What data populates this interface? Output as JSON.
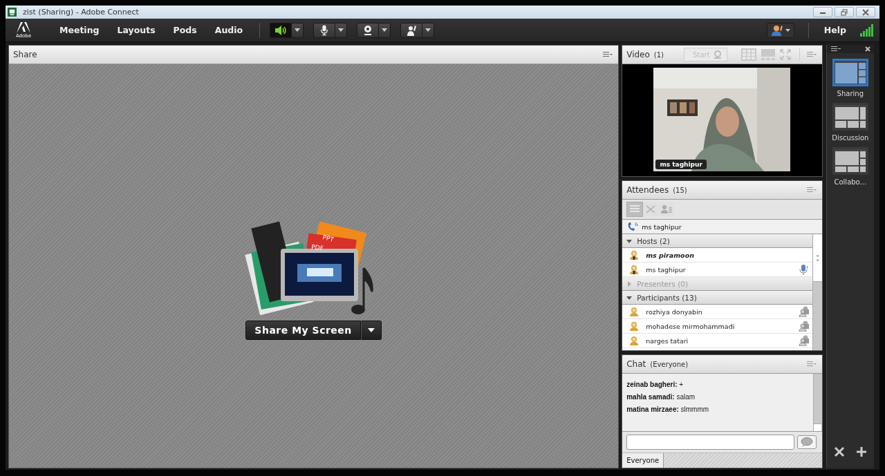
{
  "window": {
    "title": "zist (Sharing) - Adobe Connect"
  },
  "logo": {
    "text": "Adobe"
  },
  "menu": [
    {
      "label": "Meeting"
    },
    {
      "label": "Layouts"
    },
    {
      "label": "Pods"
    },
    {
      "label": "Audio"
    }
  ],
  "toolbar": [
    {
      "kind": "speaker",
      "on": true
    },
    {
      "kind": "mic",
      "on": false
    },
    {
      "kind": "camera",
      "on": false
    },
    {
      "kind": "hand",
      "on": false
    }
  ],
  "help": "Help",
  "share_pod": {
    "title": "Share",
    "button": "Share My Screen",
    "file_labels": [
      "PPT",
      "PDF"
    ]
  },
  "video_pod": {
    "title": "Video",
    "count": "(1)",
    "start": "Start",
    "name_tag": "ms taghipur"
  },
  "attendees_pod": {
    "title": "Attendees",
    "count": "(15)",
    "phone_user": "ms taghipur",
    "groups": [
      {
        "label": "Hosts (2)",
        "expanded": true,
        "children": [
          {
            "name": "ms piramoon",
            "is_me": true,
            "kind": "host",
            "mic_on": false
          },
          {
            "name": "ms taghipur",
            "is_me": false,
            "kind": "host",
            "mic_on": true
          }
        ]
      },
      {
        "label": "Presenters (0)",
        "expanded": false
      },
      {
        "label": "Participants (13)",
        "expanded": true,
        "children": [
          {
            "name": "rozhiya donyabin",
            "is_me": false,
            "kind": "participant"
          },
          {
            "name": "mohadese mirmohammadi",
            "is_me": false,
            "kind": "participant"
          },
          {
            "name": "narges tatari",
            "is_me": false,
            "kind": "participant"
          }
        ]
      }
    ]
  },
  "chat_pod": {
    "title": "Chat",
    "scope": "(Everyone)",
    "messages": [
      {
        "sender": "zeinab bagheri:",
        "text": "+"
      },
      {
        "sender": "mahla samadi:",
        "text": "salam"
      },
      {
        "sender": "matina mirzaee:",
        "text": "slmmmm"
      }
    ],
    "tabs": [
      {
        "label": "Everyone",
        "selected": true
      }
    ]
  },
  "layouts": [
    {
      "label": "Sharing",
      "selected": true,
      "kind": "sharing"
    },
    {
      "label": "Discussion",
      "selected": false,
      "kind": "discussion"
    },
    {
      "label": "Collabo...",
      "selected": false,
      "kind": "collaboration"
    }
  ]
}
